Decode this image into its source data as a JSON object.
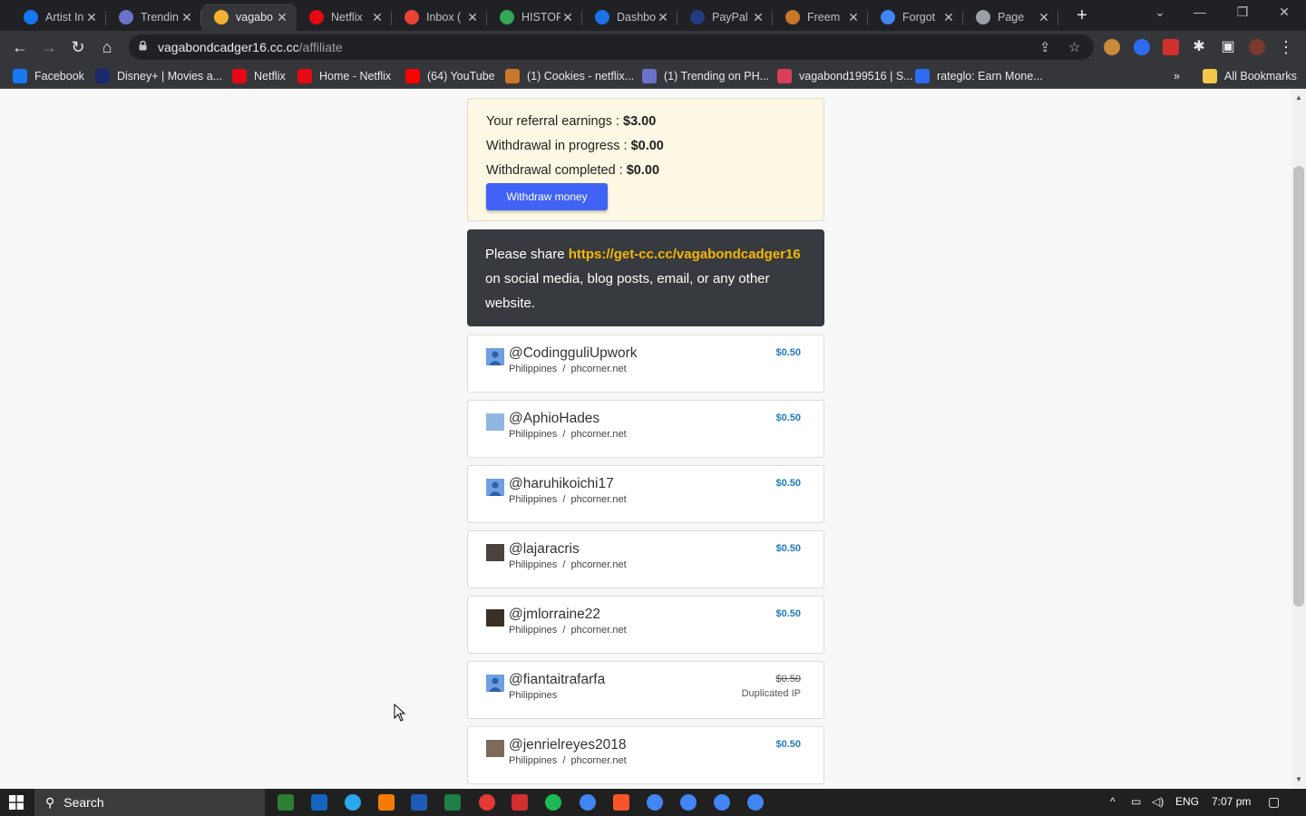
{
  "browser": {
    "tabs": [
      {
        "title": "Artist In",
        "favicon": "facebook-icon",
        "color": "#1877f2"
      },
      {
        "title": "Trendin",
        "favicon": "shield-icon",
        "color": "#6b72c9"
      },
      {
        "title": "vagabo",
        "favicon": "paw-icon",
        "color": "#f2b230",
        "active": true
      },
      {
        "title": "Netflix",
        "favicon": "netflix-icon",
        "color": "#e50914"
      },
      {
        "title": "Inbox (",
        "favicon": "gmail-icon",
        "color": "#ea4335"
      },
      {
        "title": "HISTOF",
        "favicon": "drive-icon",
        "color": "#34a853"
      },
      {
        "title": "Dashbo",
        "favicon": "dl-icon",
        "color": "#1a73e8"
      },
      {
        "title": "PayPal",
        "favicon": "paypal-icon",
        "color": "#253b80"
      },
      {
        "title": "Freem",
        "favicon": "freem-icon",
        "color": "#c9772a"
      },
      {
        "title": "Forgot",
        "favicon": "forgot-icon",
        "color": "#4285f4"
      },
      {
        "title": "Page",
        "favicon": "globe-icon",
        "color": "#9aa0a6"
      }
    ],
    "address": {
      "domain": "vagabondcadger16.cc.cc",
      "path": "/affiliate"
    },
    "bookmarks": [
      {
        "label": "Facebook",
        "color": "#1877f2"
      },
      {
        "label": "Disney+ | Movies a...",
        "color": "#1a2a6c"
      },
      {
        "label": "Netflix",
        "color": "#e50914"
      },
      {
        "label": "Home - Netflix",
        "color": "#e50914"
      },
      {
        "label": "(64) YouTube",
        "color": "#ff0000"
      },
      {
        "label": "(1) Cookies - netflix...",
        "color": "#c9772a"
      },
      {
        "label": "(1) Trending on PH...",
        "color": "#6b72c9"
      },
      {
        "label": "vagabond199516 | S...",
        "color": "#d93e5a"
      },
      {
        "label": "rateglo: Earn Mone...",
        "color": "#2d6cf0"
      }
    ],
    "all_bookmarks": "All Bookmarks"
  },
  "earnings": {
    "referral_label": "Your referral earnings : ",
    "referral_value": "$3.00",
    "in_progress_label": "Withdrawal in progress : ",
    "in_progress_value": "$0.00",
    "completed_label": "Withdrawal completed : ",
    "completed_value": "$0.00",
    "withdraw_button": "Withdraw money"
  },
  "share": {
    "prefix": "Please share ",
    "link": "https://get-cc.cc/vagabondcadger16",
    "suffix": " on social media, blog posts, email, or any other website."
  },
  "referrals": [
    {
      "username": "@CodingguliUpwork",
      "country": "Philippines",
      "source": "phcorner.net",
      "amount": "$0.50",
      "avatar": "default"
    },
    {
      "username": "@AphioHades",
      "country": "Philippines",
      "source": "phcorner.net",
      "amount": "$0.50",
      "avatar": "sky"
    },
    {
      "username": "@haruhikoichi17",
      "country": "Philippines",
      "source": "phcorner.net",
      "amount": "$0.50",
      "avatar": "default"
    },
    {
      "username": "@lajaracris",
      "country": "Philippines",
      "source": "phcorner.net",
      "amount": "$0.50",
      "avatar": "dark"
    },
    {
      "username": "@jmlorraine22",
      "country": "Philippines",
      "source": "phcorner.net",
      "amount": "$0.50",
      "avatar": "photo"
    },
    {
      "username": "@fiantaitrafarfa",
      "country": "Philippines",
      "source": "",
      "amount": "$0.50",
      "struck": true,
      "note": "Duplicated IP",
      "avatar": "default"
    },
    {
      "username": "@jenrielreyes2018",
      "country": "Philippines",
      "source": "phcorner.net",
      "amount": "$0.50",
      "avatar": "face"
    }
  ],
  "taskbar": {
    "search_label": "Search",
    "language": "ENG",
    "time": "7:07 pm"
  }
}
